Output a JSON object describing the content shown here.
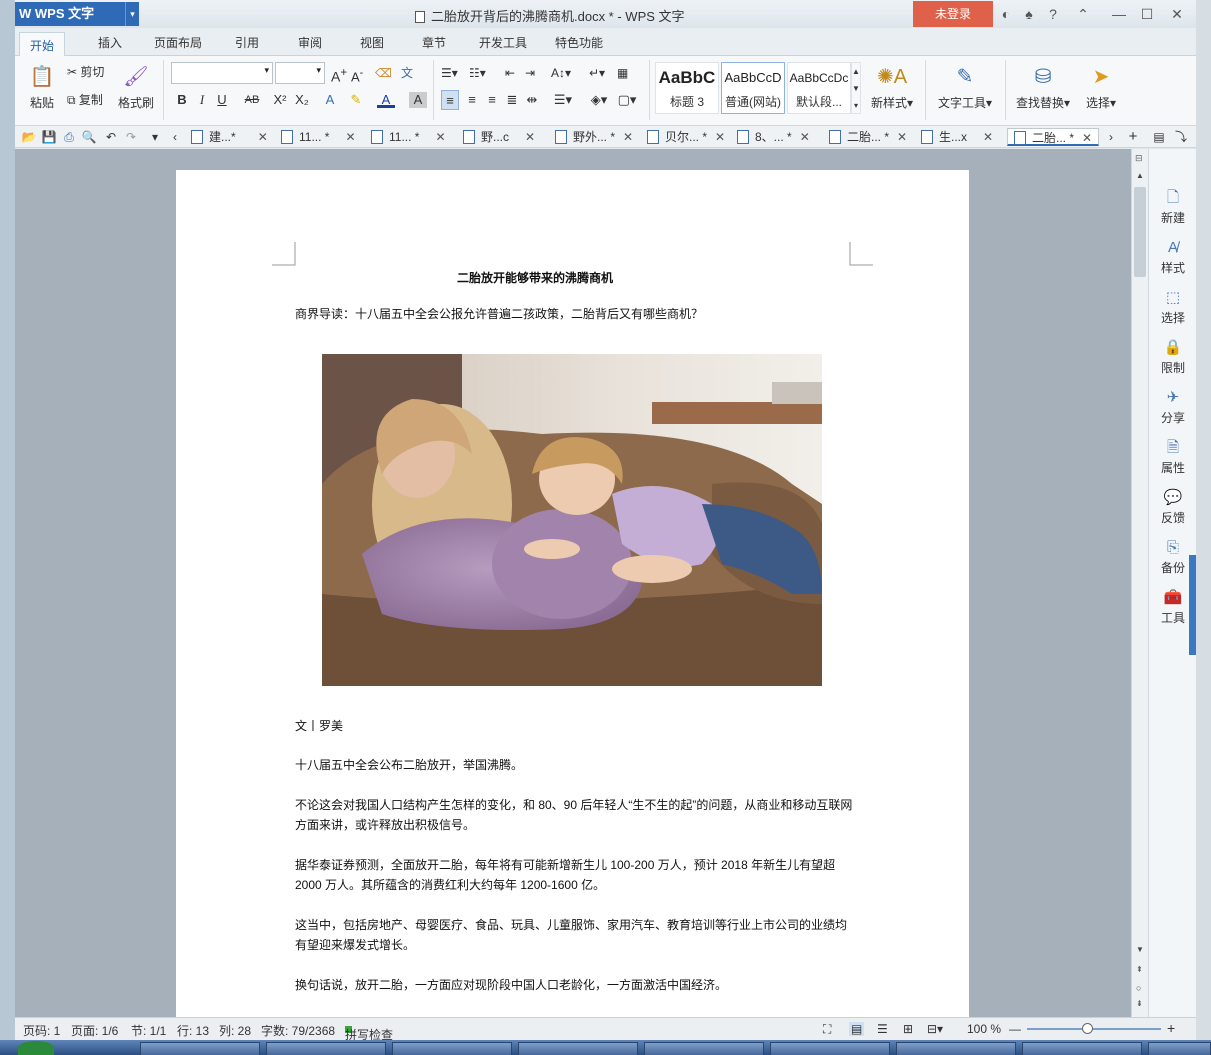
{
  "app": {
    "name": "WPS 文字",
    "window_title": "二胎放开背后的沸腾商机.docx * - WPS 文字",
    "login_label": "未登录",
    "accent": "#2f6ab7",
    "login_color": "#e0614a"
  },
  "ribbon_tabs": [
    "开始",
    "插入",
    "页面布局",
    "引用",
    "审阅",
    "视图",
    "章节",
    "开发工具",
    "特色功能"
  ],
  "ribbon": {
    "paste": "粘贴",
    "cut": "剪切",
    "copy": "复制",
    "format_painter": "格式刷",
    "styles": [
      {
        "sample": "AaBbC",
        "name": "标题 3"
      },
      {
        "sample": "AaBbCcD",
        "name": "普通(网站)"
      },
      {
        "sample": "AaBbCcDc",
        "name": "默认段..."
      }
    ],
    "new_style": "新样式",
    "text_tools": "文字工具",
    "find_replace": "查找替换",
    "select": "选择"
  },
  "doc_tabs": [
    {
      "label": "建...*"
    },
    {
      "label": "11... *"
    },
    {
      "label": "11... *"
    },
    {
      "label": "野...c"
    },
    {
      "label": "野外... *"
    },
    {
      "label": "贝尔... *"
    },
    {
      "label": "8、... *"
    },
    {
      "label": "二胎... *"
    },
    {
      "label": "生...x"
    },
    {
      "label": "二胎... *"
    }
  ],
  "document": {
    "heading": "二胎放开能够带来的沸腾商机",
    "intro": "商界导读：十八届五中全会公报允许普遍二孩政策，二胎背后又有哪些商机？",
    "byline": "文丨罗美",
    "p1": "十八届五中全会公布二胎放开，举国沸腾。",
    "p2": "不论这会对我国人口结构产生怎样的变化，和 80、90 后年轻人“生不生的起”的问题，从商业和移动互联网方面来讲，或许释放出积极信号。",
    "p3": "据华泰证券预测，全面放开二胎，每年将有可能新增新生儿 100-200 万人，预计 2018 年新生儿有望超 2000 万人。其所蕴含的消费红利大约每年 1200-1600 亿。",
    "p4": "这当中，包括房地产、母婴医疗、食品、玩具、儿童服饰、家用汽车、教育培训等行业上市公司的业绩均有望迎来爆发式增长。",
    "p5": "换句话说，放开二胎，一方面应对现阶段中国人口老龄化，一方面激活中国经济。"
  },
  "sidebar": [
    "新建",
    "样式",
    "选择",
    "限制",
    "分享",
    "属性",
    "反馈",
    "备份",
    "工具"
  ],
  "status": {
    "page_code": "页码: 1",
    "page": "页面: 1/6",
    "section": "节: 1/1",
    "row": "行: 13",
    "col": "列: 28",
    "words": "字数: 79/2368",
    "spell": "拼写检查",
    "zoom": "100 %",
    "zoom_level": 0.45
  }
}
